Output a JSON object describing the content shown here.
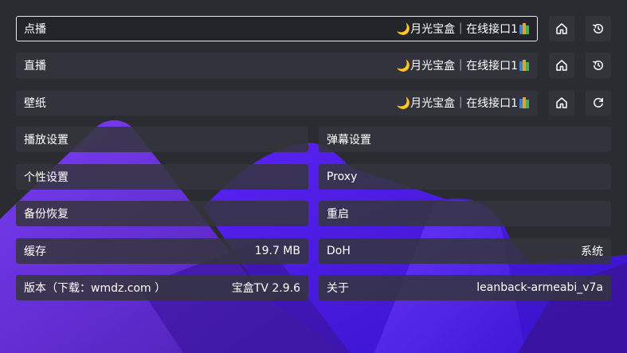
{
  "top_rows": [
    {
      "label": "点播",
      "source": "🌙月光宝盒｜在线接口1",
      "focused": true,
      "home_icon": "home-icon",
      "action_icon": "history-icon"
    },
    {
      "label": "直播",
      "source": "🌙月光宝盒｜在线接口1",
      "focused": false,
      "home_icon": "home-icon",
      "action_icon": "history-icon"
    },
    {
      "label": "壁纸",
      "source": "🌙月光宝盒｜在线接口1",
      "focused": false,
      "home_icon": "home-icon",
      "action_icon": "refresh-icon"
    }
  ],
  "settings": {
    "left": [
      {
        "label": "播放设置",
        "value": ""
      },
      {
        "label": "个性设置",
        "value": ""
      },
      {
        "label": "备份恢复",
        "value": ""
      },
      {
        "label": "缓存",
        "value": "19.7 MB"
      },
      {
        "label": "版本（下载：wmdz.com ）",
        "value": "宝盒TV 2.9.6"
      }
    ],
    "right": [
      {
        "label": "弹幕设置",
        "value": ""
      },
      {
        "label": "Proxy",
        "value": ""
      },
      {
        "label": "重启",
        "value": ""
      },
      {
        "label": "DoH",
        "value": "系统"
      },
      {
        "label": "关于",
        "value": "leanback-armeabi_v7a"
      }
    ]
  },
  "colors": {
    "background": "#2b2c31",
    "row": "#34353c",
    "accent_violet": "#6a2cf0",
    "accent_blue": "#4a17e8"
  }
}
